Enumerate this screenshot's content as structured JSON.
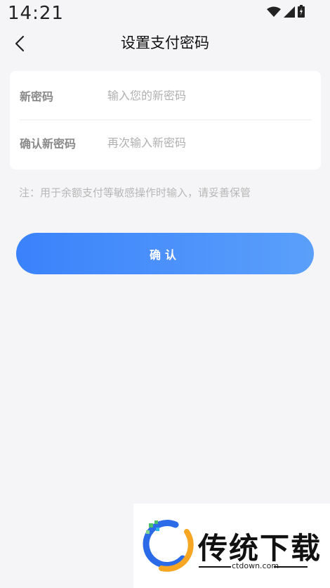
{
  "status_bar": {
    "time": "14:21",
    "icons": [
      "wifi-icon",
      "signal-icon",
      "battery-icon"
    ]
  },
  "nav": {
    "title": "设置支付密码",
    "back_icon": "chevron-left-icon"
  },
  "form": {
    "new_password": {
      "label": "新密码",
      "placeholder": "输入您的新密码",
      "value": ""
    },
    "confirm_password": {
      "label": "确认新密码",
      "placeholder": "再次输入新密码",
      "value": ""
    }
  },
  "note": "注：用于余额支付等敏感操作时输入，请妥善保管",
  "confirm_button": {
    "label": "确认"
  },
  "watermark": {
    "title": "传统下载",
    "url": "ctdown.com"
  },
  "colors": {
    "background": "#f5f5f7",
    "card": "#ffffff",
    "accent_start": "#3a82fb",
    "accent_end": "#5aa0fa",
    "label": "#8a8a8a",
    "placeholder": "#b0b0b0",
    "note": "#b7b7b7"
  }
}
